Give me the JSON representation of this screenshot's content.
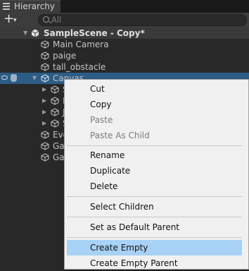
{
  "window": {
    "tab_title": "Hierarchy"
  },
  "toolbar": {
    "add_symbol": "+",
    "add_arrow": "▾"
  },
  "search": {
    "placeholder": "All"
  },
  "hierarchy": {
    "scene_name": "SampleScene - Copy*",
    "items": [
      {
        "label": "Main Camera"
      },
      {
        "label": "paige"
      },
      {
        "label": "tall_obstacle"
      },
      {
        "label": "Canvas"
      },
      {
        "label": "S"
      },
      {
        "label": "E"
      },
      {
        "label": "J"
      },
      {
        "label": "S"
      },
      {
        "label": "Eve"
      },
      {
        "label": "Ga"
      },
      {
        "label": "Ga"
      }
    ]
  },
  "context_menu": {
    "items": [
      {
        "label": "Cut",
        "enabled": true
      },
      {
        "label": "Copy",
        "enabled": true
      },
      {
        "label": "Paste",
        "enabled": false
      },
      {
        "label": "Paste As Child",
        "enabled": false
      },
      {
        "label": "Rename",
        "enabled": true
      },
      {
        "label": "Duplicate",
        "enabled": true
      },
      {
        "label": "Delete",
        "enabled": true
      },
      {
        "label": "Select Children",
        "enabled": true
      },
      {
        "label": "Set as Default Parent",
        "enabled": true
      },
      {
        "label": "Create Empty",
        "enabled": true,
        "highlighted": true
      },
      {
        "label": "Create Empty Parent",
        "enabled": true
      }
    ]
  },
  "colors": {
    "background": "#282828",
    "selection": "#2c5d87",
    "menu_background": "#f0f0f0",
    "menu_highlight": "#a7d1f5"
  }
}
